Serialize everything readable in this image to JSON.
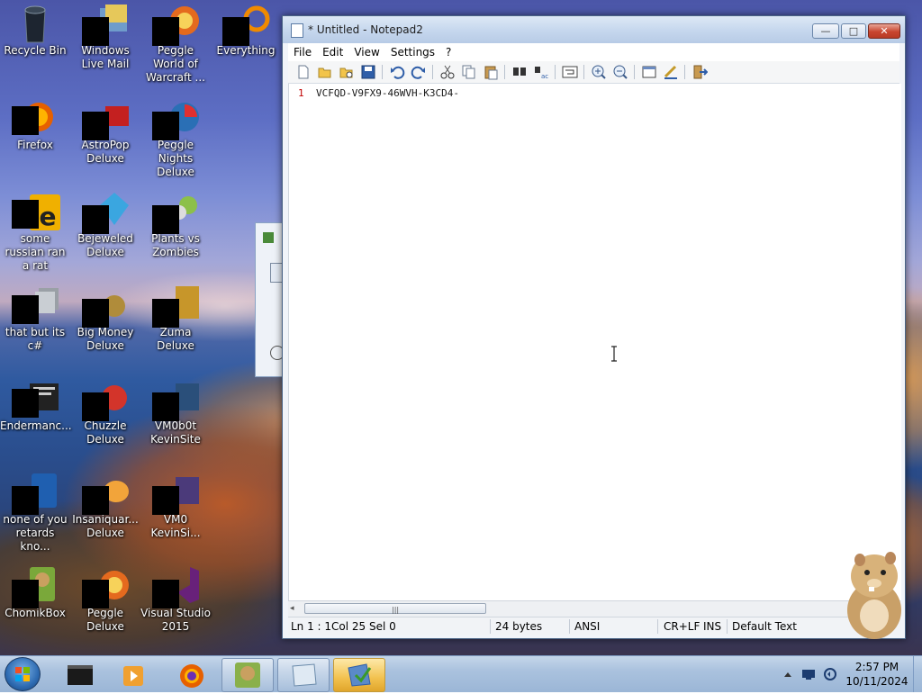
{
  "desktop": {
    "icons": [
      {
        "label": "Recycle Bin"
      },
      {
        "label": "Windows Live Mail"
      },
      {
        "label": "Peggle World of Warcraft ..."
      },
      {
        "label": "Everything"
      },
      {
        "label": "Firefox"
      },
      {
        "label": "AstroPop Deluxe"
      },
      {
        "label": "Peggle Nights Deluxe"
      },
      {
        "label": "some russian ran a rat"
      },
      {
        "label": "Bejeweled Deluxe"
      },
      {
        "label": "Plants vs Zombies"
      },
      {
        "label": "that but its c#"
      },
      {
        "label": "Big Money Deluxe"
      },
      {
        "label": "Zuma Deluxe"
      },
      {
        "label": "Endermanc..."
      },
      {
        "label": "Chuzzle Deluxe"
      },
      {
        "label": "VM0b0t KevinSite"
      },
      {
        "label": "none of you retards kno..."
      },
      {
        "label": "Insaniquar... Deluxe"
      },
      {
        "label": "VM0 KevinSi..."
      },
      {
        "label": "ChomikBox"
      },
      {
        "label": "Peggle Deluxe"
      },
      {
        "label": "Visual Studio 2015"
      }
    ]
  },
  "notepad": {
    "title": "* Untitled - Notepad2",
    "window_buttons": {
      "minimize": "—",
      "maximize": "□",
      "close": "✕"
    },
    "menu": [
      "File",
      "Edit",
      "View",
      "Settings",
      "?"
    ],
    "toolbar": [
      "new-icon",
      "open-icon",
      "browse-icon",
      "save-icon",
      "undo-icon",
      "redo-icon",
      "cut-icon",
      "copy-icon",
      "paste-icon",
      "find-icon",
      "replace-icon",
      "word-wrap-icon",
      "zoom-in-icon",
      "zoom-out-icon",
      "scheme-icon",
      "customize-icon",
      "exit-icon"
    ],
    "editor": {
      "line_number": "1",
      "content": "VCFQD-V9FX9-46WVH-K3CD4-"
    },
    "status": {
      "position": "Ln 1 : 1",
      "column": "Col 25",
      "selection": "Sel 0",
      "size": "24 bytes",
      "encoding": "ANSI",
      "line_endings": "CR+LF",
      "mode": "INS",
      "scheme": "Default Text"
    },
    "scroll_left": "◂",
    "scroll_grip": "|||"
  },
  "taskbar": {
    "clock_time": "2:57 PM",
    "clock_date": "10/11/2024"
  },
  "colors": {
    "line_number": "#c00000",
    "close_button": "#c8452f",
    "active_task": "#f2c14e"
  }
}
